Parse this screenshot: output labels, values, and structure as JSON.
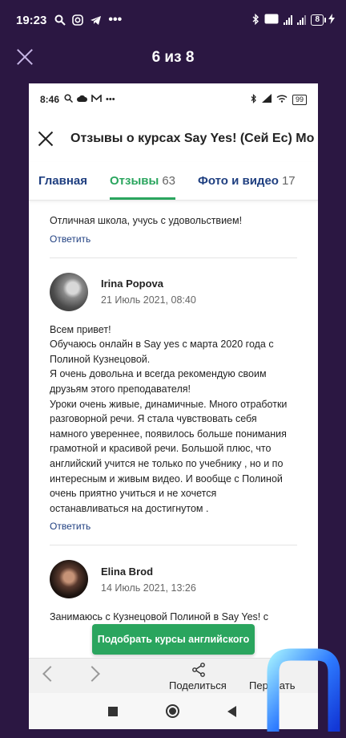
{
  "outer_status": {
    "time": "19:23",
    "battery": "8"
  },
  "viewer": {
    "counter": "6 из 8"
  },
  "inner_status": {
    "time": "8:46",
    "battery": "99"
  },
  "app": {
    "title": "Отзывы о курсах Say Yes! (Сей Ес) Мо"
  },
  "tabs": [
    {
      "label": "Главная",
      "count": ""
    },
    {
      "label": "Отзывы",
      "count": "63"
    },
    {
      "label": "Фото и видео",
      "count": "17"
    }
  ],
  "reviews": [
    {
      "text": "Отличная школа, учусь с удовольствием!",
      "reply": "Ответить"
    },
    {
      "name": "Irina Popova",
      "date": "21 Июль 2021, 08:40",
      "lines": [
        "Всем привет!",
        "Обучаюсь онлайн в Say yes с марта 2020 года с",
        "Полиной Кузнецовой.",
        "Я очень довольна и всегда рекомендую своим",
        "друзьям этого преподавателя!",
        "Уроки очень живые, динамичные. Много отработки",
        "разговорной речи. Я стала чувствовать себя",
        "намного увереннее, появилось больше понимания",
        "грамотной и красивой речи. Большой плюс, что",
        "английский учится не только по учебнику , но и по",
        "интересным и живым видео. И вообще с Полиной",
        "очень приятно учиться и не хочется",
        "останавливаться на достигнутом ."
      ],
      "reply": "Ответить"
    },
    {
      "name": "Elina Brod",
      "date": "14 Июль 2021, 13:26",
      "text": "Занимаюсь с Кузнецовой Полиной в Say Yes! с"
    }
  ],
  "cta": {
    "label": "Подобрать курсы английского"
  },
  "bottom_bar": {
    "share_label": "Поделиться",
    "translate_label": "Перевать"
  },
  "colors": {
    "accent_green": "#2aa55e",
    "link_blue": "#1f3f80",
    "viewer_bg": "#2b1742"
  }
}
